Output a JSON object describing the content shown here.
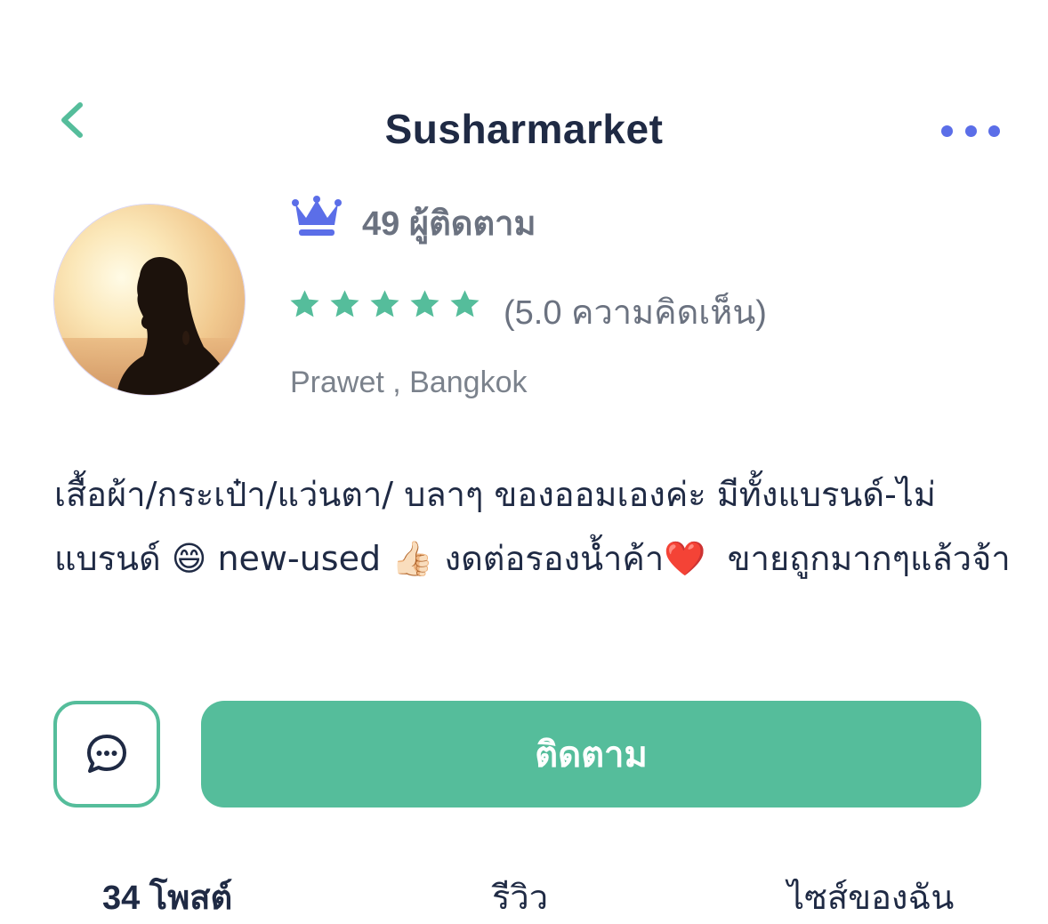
{
  "header": {
    "title": "Susharmarket",
    "back_icon": "chevron-left-icon",
    "more_icon": "more-horizontal-icon"
  },
  "profile": {
    "followers_text": "49 ผู้ติดตาม",
    "rating_value": 5.0,
    "rating_text": "(5.0 ความคิดเห็น)",
    "location": "Prawet ,  Bangkok",
    "bio": "เสื้อผ้า/กระเป๋า/แว่นตา/ บลาๆ ของออมเองค่ะ มีทั้งแบรนด์-ไม่แบรนด์ 😄 new-used 👍🏻 งดต่อรองน้ำค้า❤️  ขายถูกมากๆแล้วจ้า"
  },
  "actions": {
    "follow_label": "ติดตาม",
    "chat_icon": "chat-bubble-icon"
  },
  "tabs": [
    {
      "label": "34 โพสต์"
    },
    {
      "label": "รีวิว"
    },
    {
      "label": "ไซส์ของฉัน"
    }
  ],
  "colors": {
    "accent_green": "#55bd9b",
    "accent_blue": "#5b6ee8",
    "text_dark": "#1f2a44",
    "text_muted": "#6b7280"
  }
}
